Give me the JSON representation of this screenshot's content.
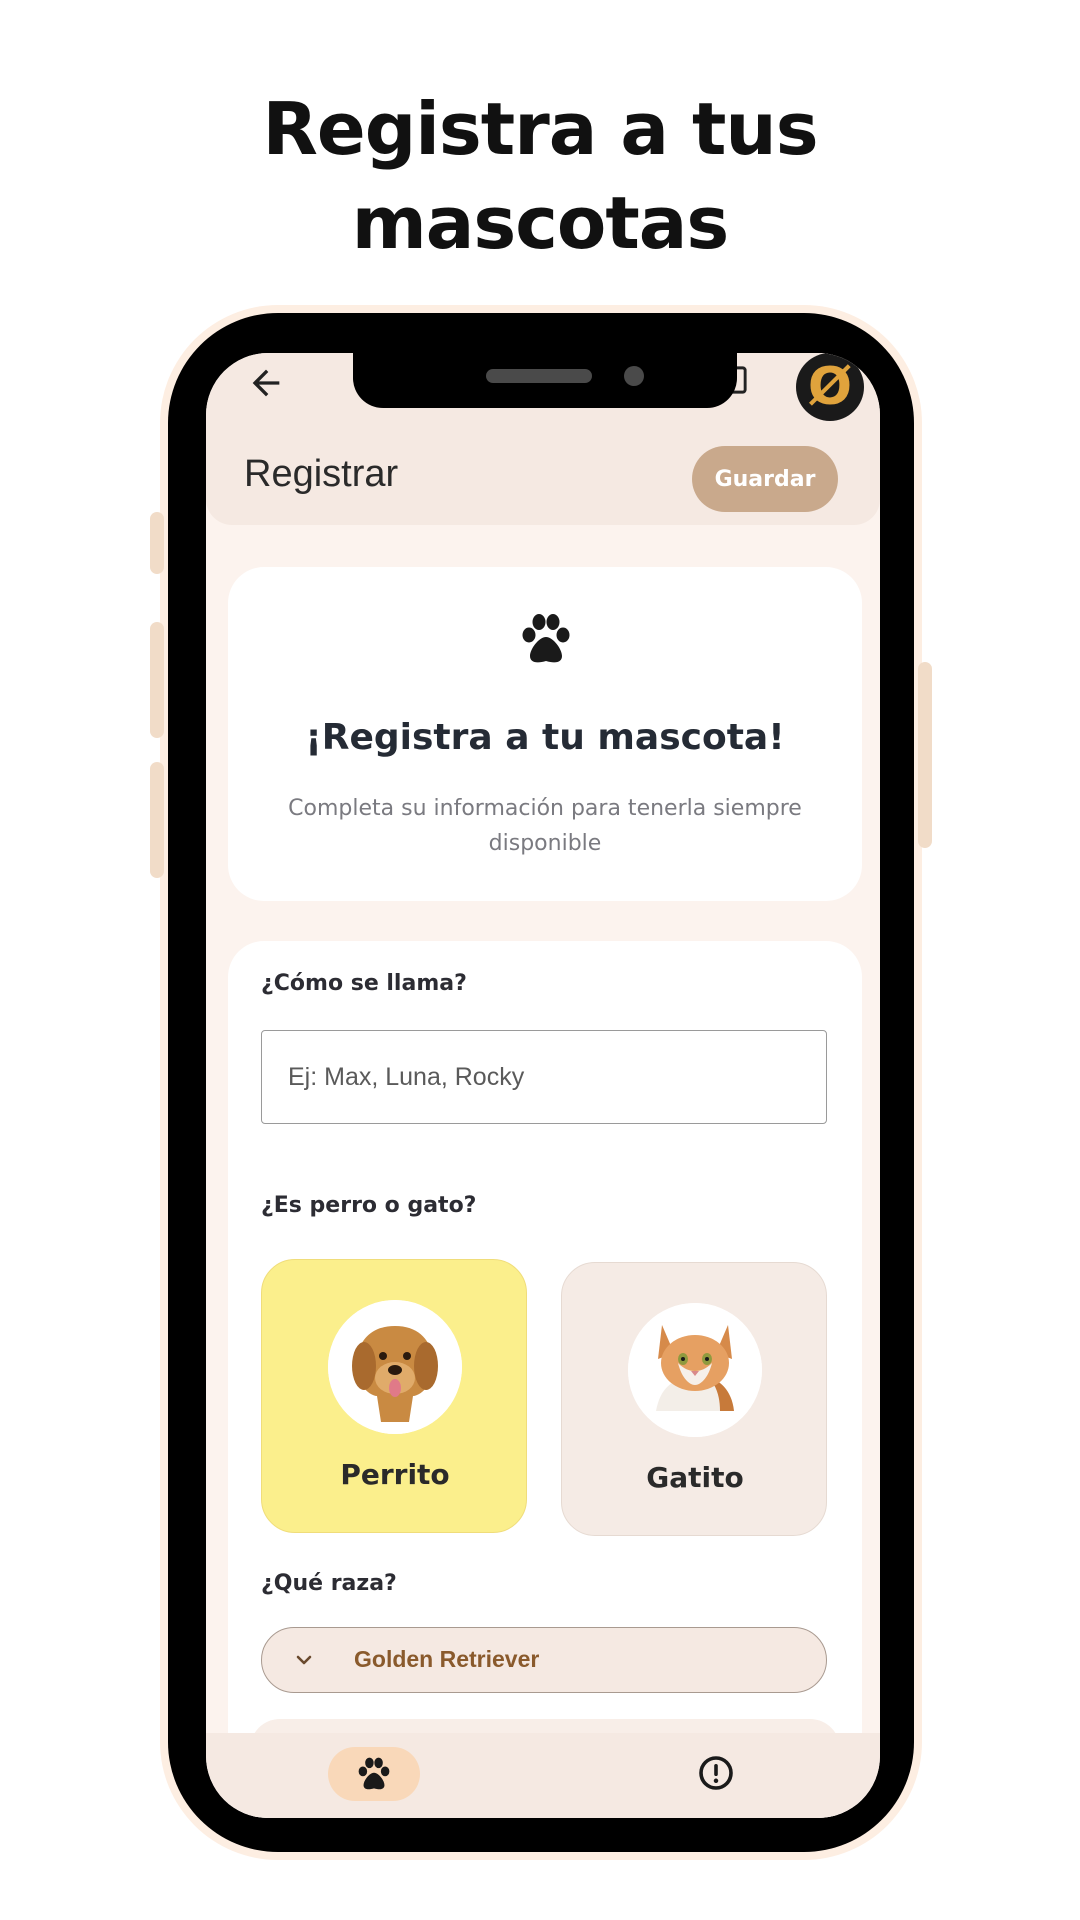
{
  "headline": {
    "line1": "Registra a tus",
    "line2": "mascotas"
  },
  "appbar": {
    "title": "Registrar",
    "save_label": "Guardar",
    "brand_badge": "Ø"
  },
  "intro": {
    "title": "¡Registra a tu mascota!",
    "subtitle": "Completa su información para tenerla siempre disponible"
  },
  "form": {
    "name_label": "¿Cómo se llama?",
    "name_placeholder": "Ej: Max, Luna, Rocky",
    "name_value": "",
    "type_label": "¿Es perro o gato?",
    "types": [
      {
        "label": "Perrito",
        "selected": true
      },
      {
        "label": "Gatito",
        "selected": false
      }
    ],
    "breed_label": "¿Qué raza?",
    "breed_value": "Golden Retriever"
  },
  "bottom_nav": {
    "items": [
      {
        "icon": "paw-icon",
        "label": "",
        "active": true
      },
      {
        "icon": "alert-circle-icon",
        "label": "",
        "active": false
      }
    ]
  },
  "colors": {
    "selected_option": "#fbef8c",
    "save_button": "#c9a98c",
    "breed_text": "#8a5a2c",
    "brand_badge": "#e0a33c"
  }
}
